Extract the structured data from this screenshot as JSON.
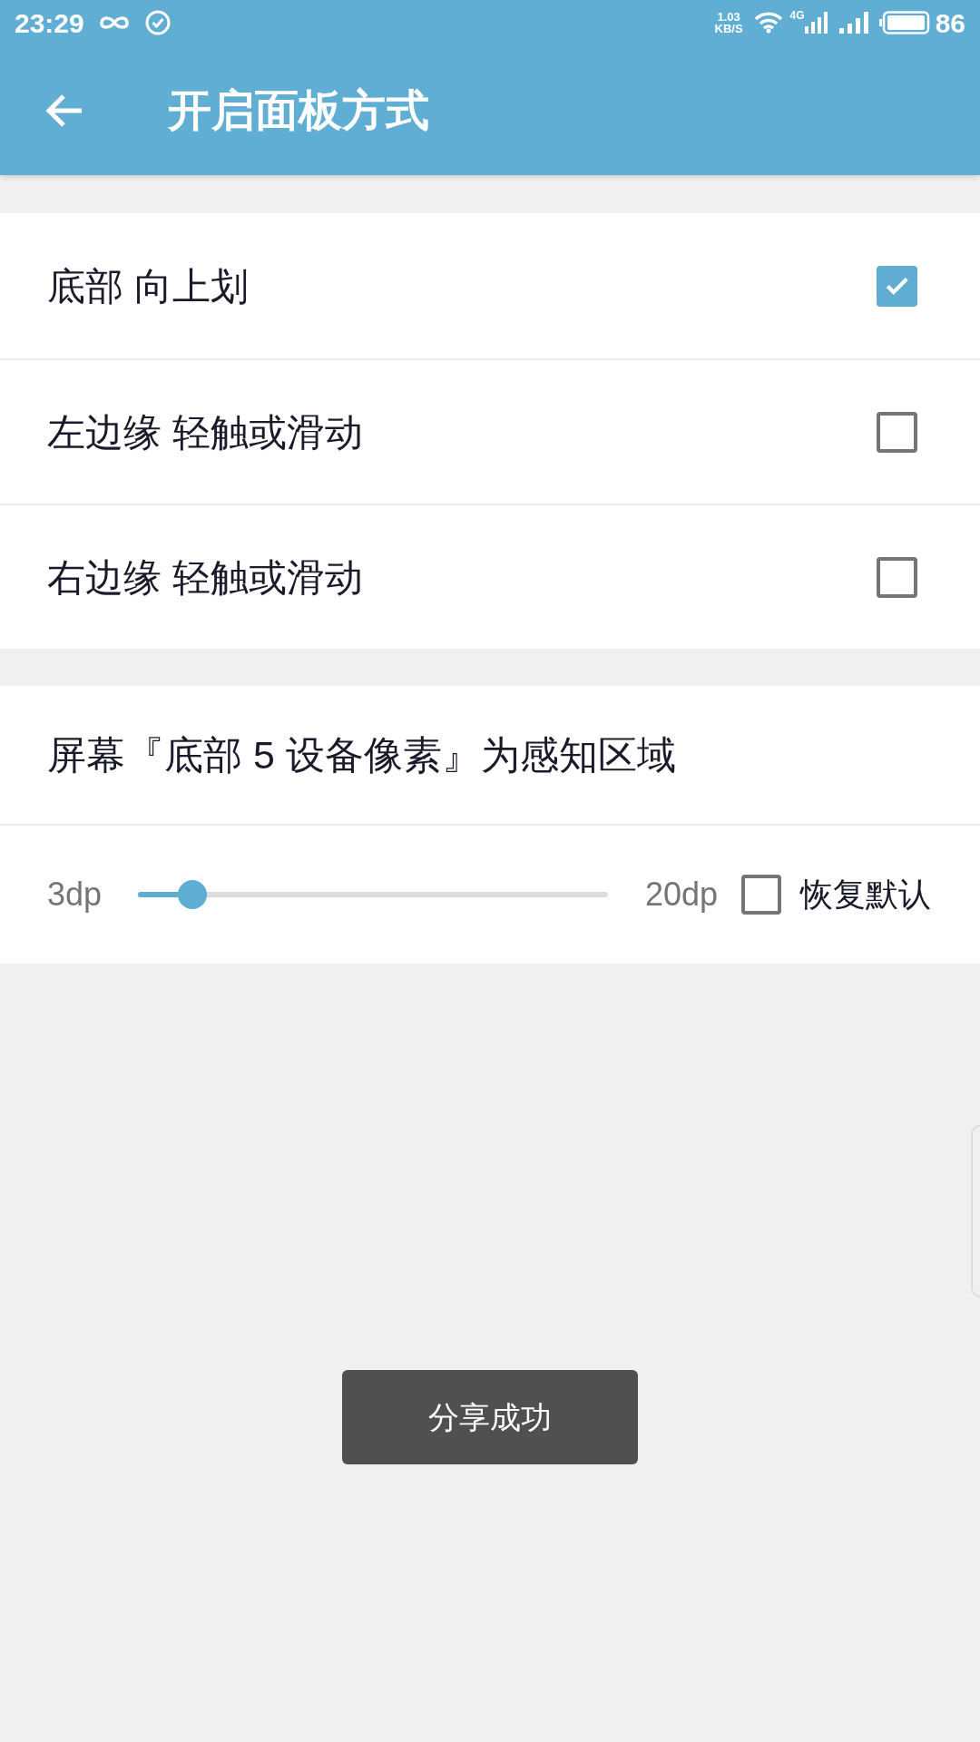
{
  "status_bar": {
    "time": "23:29",
    "speed_value": "1.03",
    "speed_unit": "KB/S",
    "network": "4G",
    "battery": "86"
  },
  "toolbar": {
    "title": "开启面板方式"
  },
  "options": [
    {
      "label": "底部 向上划",
      "checked": true
    },
    {
      "label": "左边缘 轻触或滑动",
      "checked": false
    },
    {
      "label": "右边缘 轻触或滑动",
      "checked": false
    }
  ],
  "sensing_area": {
    "title": "屏幕『底部 5 设备像素』为感知区域",
    "slider": {
      "min_label": "3dp",
      "max_label": "20dp",
      "level": 0.116
    },
    "reset": {
      "label": "恢复默认",
      "checked": false
    }
  },
  "toast": {
    "text": "分享成功"
  }
}
